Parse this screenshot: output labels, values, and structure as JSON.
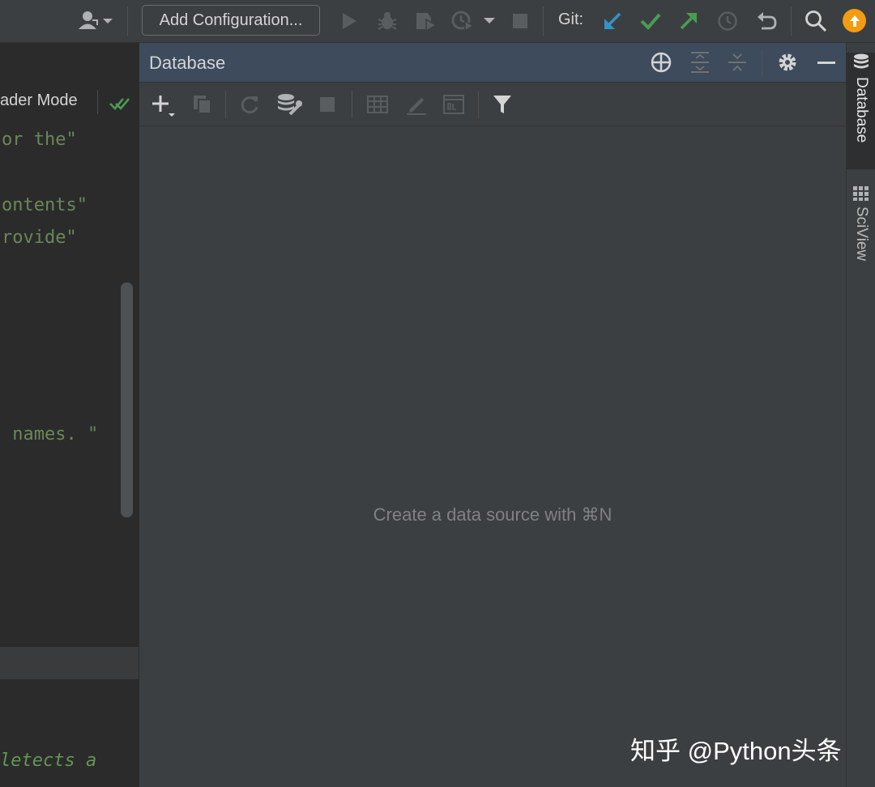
{
  "toolbar": {
    "add_configuration": "Add Configuration...",
    "git_label": "Git:",
    "icons": [
      "user-icon",
      "run-icon",
      "debug-icon",
      "coverage-icon",
      "profile-icon",
      "stop-icon",
      "git-update-icon",
      "git-commit-icon",
      "git-push-icon",
      "history-icon",
      "rollback-icon",
      "search-icon",
      "update-icon"
    ]
  },
  "editor": {
    "reader_mode": "ader Mode",
    "lines": [
      {
        "text": "or the\""
      },
      {
        "text": "ontents\""
      },
      {
        "text": "rovide\""
      },
      {
        "text": " names. \""
      }
    ],
    "bottom_line": "letects a"
  },
  "panel": {
    "title": "Database",
    "empty_hint": "Create a data source with ⌘N"
  },
  "stripe": {
    "database_tab": "Database",
    "sciview_tab": "SciView"
  },
  "watermark": "知乎 @Python头条",
  "colors": {
    "git_update": "#3592c4",
    "git_commit": "#499c54",
    "git_push": "#499c54",
    "update_badge": "#f39c12",
    "string_green": "#6a8759"
  }
}
